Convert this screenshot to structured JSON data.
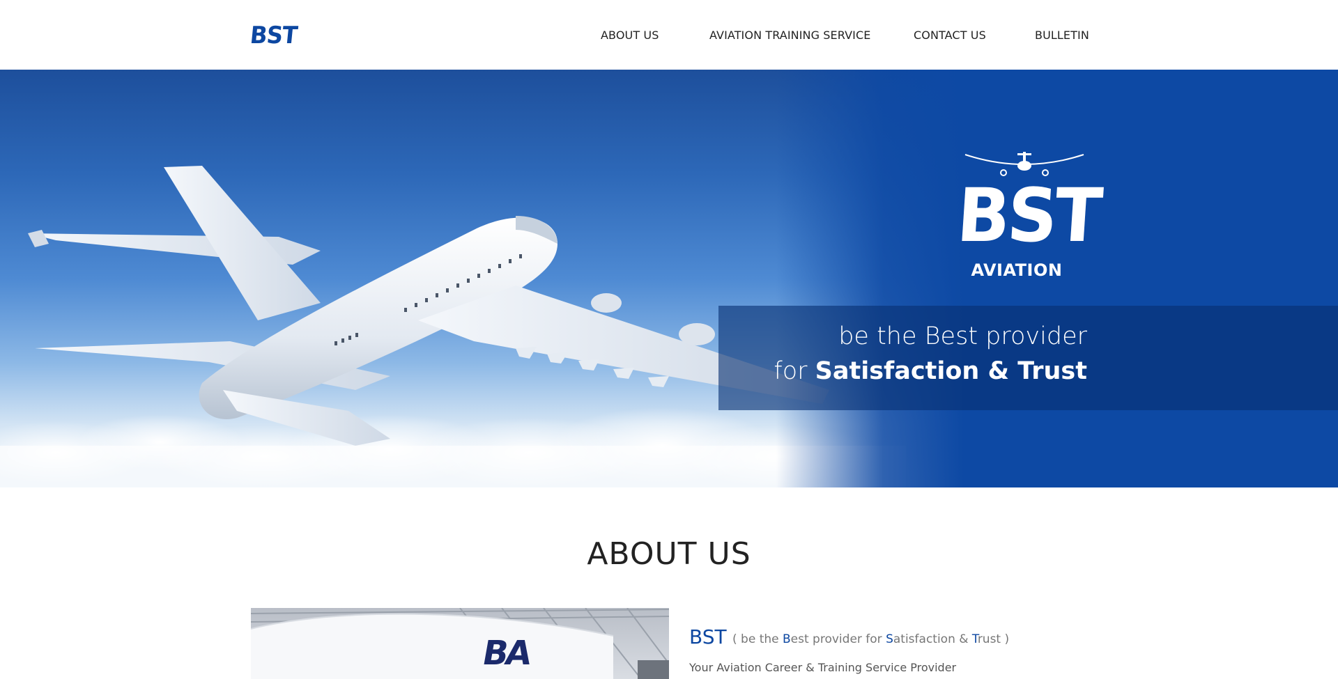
{
  "header": {
    "logo_text": "BST",
    "nav": [
      {
        "label": "ABOUT US"
      },
      {
        "label": "AVIATION TRAINING SERVICE"
      },
      {
        "label": "CONTACT US"
      },
      {
        "label": "BULLETIN"
      }
    ]
  },
  "hero": {
    "logo_text": "BST",
    "logo_sub": "AVIATION",
    "tagline_line1": "be the Best provider",
    "tagline_line2_prefix": "for ",
    "tagline_line2_emphasis": "Satisfaction & Trust"
  },
  "about": {
    "title": "ABOUT US",
    "brand": "BST",
    "subtitle_parts": [
      {
        "text": "( be the ",
        "highlight": false
      },
      {
        "text": "B",
        "highlight": true
      },
      {
        "text": "est provider for ",
        "highlight": false
      },
      {
        "text": "S",
        "highlight": true
      },
      {
        "text": "atisfaction & ",
        "highlight": false
      },
      {
        "text": "T",
        "highlight": true
      },
      {
        "text": "rust )",
        "highlight": false
      }
    ],
    "description": "Your Aviation Career & Training Service Provider",
    "image_logo_text": "BA"
  },
  "colors": {
    "brand_blue": "#0d47a1",
    "hero_blue": "#0d49a4",
    "text_dark": "#222222"
  }
}
